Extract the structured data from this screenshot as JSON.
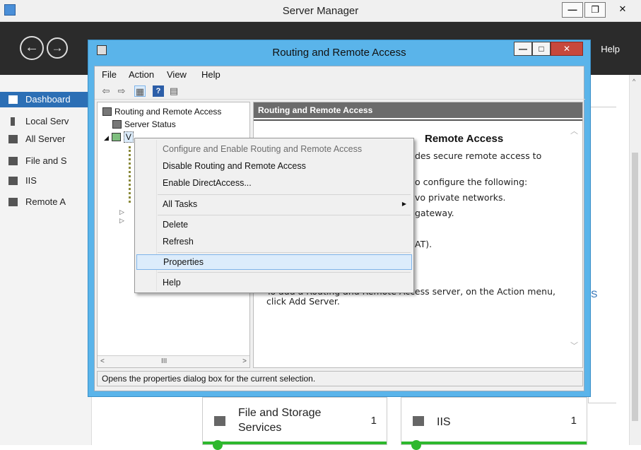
{
  "server_manager": {
    "title": "Server Manager",
    "window_controls": {
      "minimize": "—",
      "maximize": "❐",
      "close": "✕"
    },
    "help": "Help",
    "sidebar": [
      {
        "label": "Dashboard",
        "icon": "dashboard-icon"
      },
      {
        "label": "Local Serv",
        "icon": "server-icon"
      },
      {
        "label": "All Server",
        "icon": "servers-icon"
      },
      {
        "label": "File and S",
        "icon": "file-storage-icon"
      },
      {
        "label": "IIS",
        "icon": "iis-icon"
      },
      {
        "label": "Remote A",
        "icon": "remote-access-icon"
      }
    ],
    "tiles": [
      {
        "name": "File and Storage Services",
        "count": "1"
      },
      {
        "name": "IIS",
        "count": "1"
      }
    ],
    "peek_text": "S"
  },
  "rras": {
    "title": "Routing and Remote Access",
    "window_controls": {
      "minimize": "—",
      "maximize": "□",
      "close": "✕"
    },
    "menu": [
      "File",
      "Action",
      "View",
      "Help"
    ],
    "tree": {
      "root": "Routing and Remote Access",
      "server_status": "Server Status",
      "server_node": "V"
    },
    "right_pane": {
      "header": "Routing and Remote Access",
      "heading": "Remote Access",
      "lines": [
        "des secure remote access to",
        "o configure the following:",
        "vo private networks.",
        "gateway.",
        "AT).",
        "To add a Routing and Remote Access server, on the Action menu,",
        "click Add Server."
      ]
    },
    "status": "Opens the properties dialog box for the current selection."
  },
  "context_menu": {
    "items": [
      {
        "label": "Configure and Enable Routing and Remote Access",
        "disabled": true
      },
      {
        "label": "Disable Routing and Remote Access"
      },
      {
        "label": "Enable DirectAccess..."
      },
      {
        "label": "All Tasks",
        "submenu": true
      },
      {
        "label": "Delete"
      },
      {
        "label": "Refresh"
      },
      {
        "label": "Properties",
        "highlighted": true
      },
      {
        "label": "Help"
      }
    ]
  }
}
